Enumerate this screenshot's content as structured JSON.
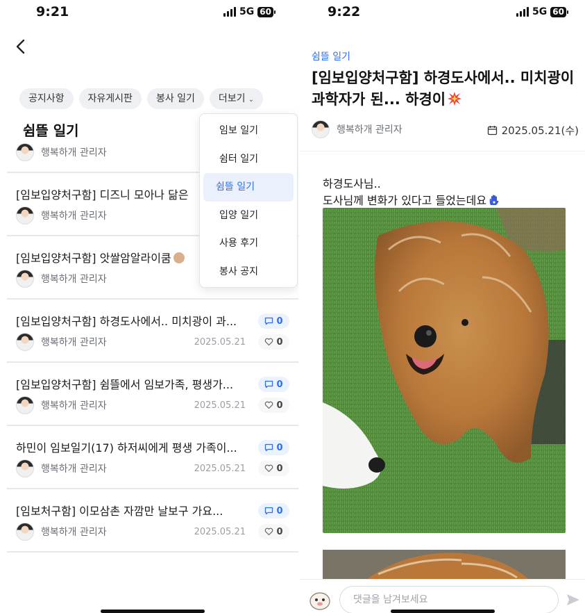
{
  "colors": {
    "accent": "#2f6fed",
    "chip_bg": "#eef0f3",
    "selected_bg": "#eaf1fc"
  },
  "left": {
    "status": {
      "time": "9:21",
      "network": "5G",
      "battery": "60"
    },
    "chips": [
      "공지사항",
      "자유게시판",
      "봉사 일기",
      "더보기"
    ],
    "board_title": "쉼뜰 일기",
    "partial_author": "행복하개 관리자",
    "dropdown": [
      "임보 일기",
      "쉼터 일기",
      "쉼뜰 일기",
      "입양 일기",
      "사용 후기",
      "봉사 공지"
    ],
    "dropdown_selected": "쉼뜰 일기",
    "posts": [
      {
        "title": "[임보입양처구함] 디즈니 모아나 닮은",
        "author": "행복하개 관리자"
      },
      {
        "title": "[임보입양처구함] 앗쌀암알라이쿰",
        "author": "행복하개 관리자"
      },
      {
        "title": "[임보입양처구함] 하경도사에서.. 미치광이 과...",
        "author": "행복하개 관리자",
        "date": "2025.05.21",
        "comments": "0",
        "likes": "0"
      },
      {
        "title": "[임보입양처구함] 쉼뜰에서 임보가족, 평생가...",
        "author": "행복하개 관리자",
        "date": "2025.05.21",
        "comments": "0",
        "likes": "0"
      },
      {
        "title": "하민이 임보일기(17) 하저씨에게 평생 가족이...",
        "author": "행복하개 관리자",
        "date": "2025.05.21",
        "comments": "0",
        "likes": "0"
      },
      {
        "title": "[임보처구함] 이모삼촌 자깜만 날보구 가요...",
        "author": "행복하개 관리자",
        "date": "2025.05.21",
        "comments": "0",
        "likes": "0"
      }
    ]
  },
  "right": {
    "status": {
      "time": "9:22",
      "network": "5G",
      "battery": "60"
    },
    "category": "쉼뜰 일기",
    "title_line1": "[임보입양처구함] 하경도사에서.. 미치광이",
    "title_line2": "과학자가 된... 하경이",
    "author": "행복하개 관리자",
    "date": "2025.05.21(수)",
    "body_line1": "하경도사님..",
    "body_line2": "도사님께 변화가 있다고 들었는데요",
    "comment_placeholder": "댓글을 남겨보세요"
  }
}
